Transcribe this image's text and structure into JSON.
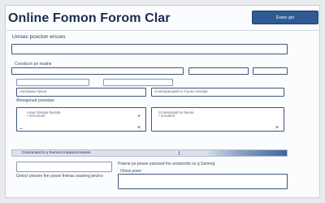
{
  "form": {
    "title": "Online Fomon Forom Clar",
    "header_button": "Exsec get",
    "section_heading": "Unisec poscton ercces",
    "field1_label": "Consticon pe nsatne",
    "row2": {
      "left_label": "Controy Sorpoce nee cenaratl",
      "right_label": "Tenote to pe tsamaocad"
    },
    "field3": {
      "label": "Atrosgenad posavipe",
      "text": "Aacrspaw rtysoe",
      "right_text": "Cnesmpanyael to Guono eecepe"
    },
    "panels": {
      "left_line1": "Aoxe Grenpe faonde",
      "left_line2": "• etmoseae",
      "right_line1": "Ccnesminalt ar tteone",
      "right_line2": "• annabtol"
    },
    "section_bar_label": "Gosnanancrs y tnenoro impascecnanes",
    "bottom": {
      "left_label": "Gntocl pnsoen fee posse fretnac ssaeing pecino",
      "right_label": "Pstene po posee psessed fne aroetondo os g Sammg",
      "right_sub": "Ohnsi poerr"
    },
    "marks": {
      "plus": "+",
      "cross": "×",
      "dash": "–",
      "slash": "⁄"
    }
  }
}
